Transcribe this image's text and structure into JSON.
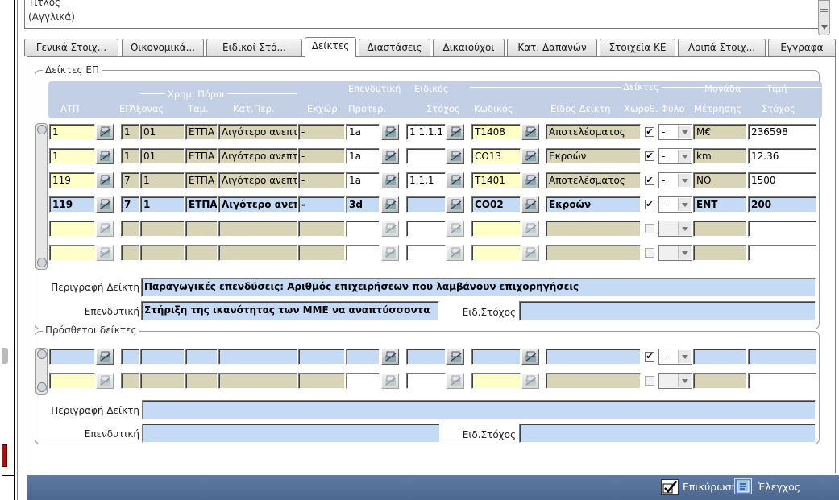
{
  "top": {
    "field_label_line1": "Τίτλος",
    "field_label_line2": "(Αγγλικά)"
  },
  "tabs": [
    {
      "label": "Γενικά Στοιχ..."
    },
    {
      "label": "Οικονομικά..."
    },
    {
      "label": "Ειδικοί Στό..."
    },
    {
      "label": "Δείκτες"
    },
    {
      "label": "Διαστάσεις"
    },
    {
      "label": "Δικαιούχοι"
    },
    {
      "label": "Κατ. Δαπανών"
    },
    {
      "label": "Στοιχεία ΚΕ"
    },
    {
      "label": "Λοιπά Στοιχ..."
    },
    {
      "label": "Εγγραφα"
    }
  ],
  "active_tab": "Δείκτες",
  "indicators": {
    "legend": "Δείκτες ΕΠ",
    "headers": {
      "group_pori": "Χρημ. Πόροι",
      "group_ependytiki": "Επενδυτική",
      "group_eidikos": "Ειδικός",
      "group_deiktes": "Δείκτες",
      "atp": "ΑΤΠ",
      "ep": "ΕΠ",
      "axonas": "Άξονας",
      "tam": "Ταμ.",
      "katper": "Κατ.Περ.",
      "ekxor": "Εκχώρ.",
      "proter": "Προτερ.",
      "stoxos": "Στόχος",
      "kodikos": "Κωδικός",
      "eidos": "Είδος Δείκτη",
      "xoroth": "Χωροθ.",
      "fylo": "Φύλο",
      "monada1": "Μονάδα",
      "monada2": "Μέτρησης",
      "timi1": "Τιμή",
      "timi2": "Στόχος"
    },
    "rows": [
      {
        "atp": "1",
        "ep": "1",
        "axonas": "01",
        "tam": "ΕΤΠΑ",
        "katper": "Λιγότερο ανεπτ",
        "ekxor": "-",
        "proter": "1a",
        "stoxos": "1.1.1.1",
        "kodikos": "T1408",
        "eidos": "Αποτελέσματος",
        "xoroth": "✔",
        "fylo": "-",
        "monada": "M€",
        "timi": "236598"
      },
      {
        "atp": "1",
        "ep": "1",
        "axonas": "01",
        "tam": "ΕΤΠΑ",
        "katper": "Λιγότερο ανεπτ",
        "ekxor": "-",
        "proter": "1a",
        "stoxos": "",
        "kodikos": "CO13",
        "eidos": "Εκροών",
        "xoroth": "✔",
        "fylo": "-",
        "monada": "km",
        "timi": "12.36"
      },
      {
        "atp": "119",
        "ep": "7",
        "axonas": "1",
        "tam": "ΕΤΠΑ",
        "katper": "Λιγότερο ανεπτ",
        "ekxor": "-",
        "proter": "1a",
        "stoxos": "1.1.1",
        "kodikos": "T1401",
        "eidos": "Αποτελέσματος",
        "xoroth": "✔",
        "fylo": "-",
        "monada": "NO",
        "timi": "1500"
      },
      {
        "atp": "119",
        "ep": "7",
        "axonas": "1",
        "tam": "ΕΤΠΑ",
        "katper": "Λιγότερο ανεπ",
        "ekxor": "-",
        "proter": "3d",
        "stoxos": "",
        "kodikos": "CO02",
        "eidos": "Εκροών",
        "xoroth": "✔",
        "fylo": "-",
        "monada": "ENT",
        "timi": "200"
      }
    ],
    "desc_label": "Περιγραφή Δείκτη",
    "desc_value": "Παραγωγικές επενδύσεις: Αριθμός επιχειρήσεων που λαμβάνουν επιχορηγήσεις",
    "ependytiki_label": "Επενδυτική",
    "ependytiki_value": "Στήριξη της ικανότητας των ΜΜΕ να αναπτύσσοντα",
    "eidstoxos_label": "Ειδ.Στόχος",
    "eidstoxos_value": ""
  },
  "additional": {
    "legend": "Πρόσθετοι δείκτες",
    "row1_xoroth": "✔",
    "row1_fylo": "-",
    "desc_label": "Περιγραφή Δείκτη",
    "ependytiki_label": "Επενδυτική",
    "eidstoxos_label": "Ειδ.Στόχος"
  },
  "statusbar": {
    "confirm_label": "Επικύρωση",
    "check_label": "Έλεγχος"
  },
  "colors": {
    "status_bar": "#5a7aa8",
    "header_band": "#c3cfe4",
    "blue_cell": "#c4daf5",
    "yellow_cell": "#ffffc8",
    "tan_cell": "#d8d4b8"
  }
}
